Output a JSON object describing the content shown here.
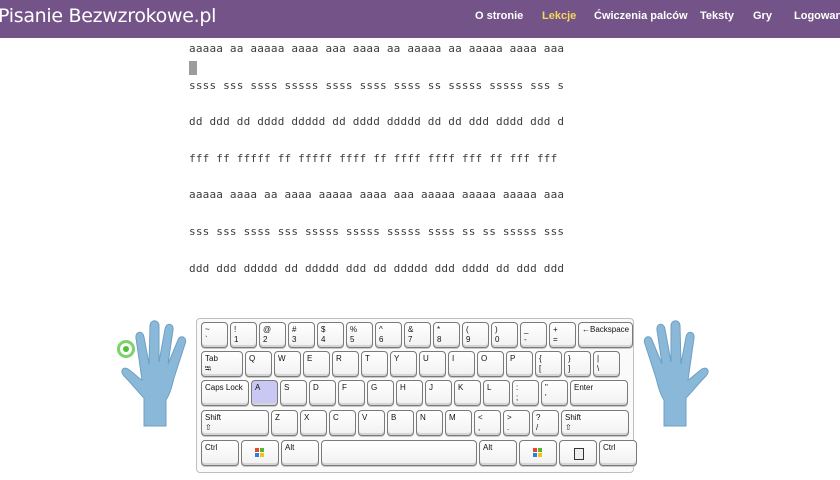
{
  "brand": "Pisanie Bezwzrokowe.pl",
  "nav": {
    "items": [
      {
        "label": "O stronie",
        "active": false
      },
      {
        "label": "Lekcje",
        "active": true
      },
      {
        "label": "Ćwiczenia palców",
        "active": false
      },
      {
        "label": "Teksty",
        "active": false
      },
      {
        "label": "Gry",
        "active": false
      },
      {
        "label": "Logowanie",
        "active": false
      }
    ]
  },
  "exercise": {
    "lines": [
      "aaaaa aa aaaaa aaaa aaa aaaa aa aaaaa aa aaaaa aaaa aaa",
      "ssss sss ssss sssss ssss ssss ssss ss sssss sssss sss s",
      "dd ddd dd dddd ddddd dd dddd ddddd dd dd ddd dddd ddd d",
      "fff ff fffff ff fffff ffff ff ffff ffff fff ff fff fff",
      "aaaaa aaaa aa aaaa aaaaa aaaa aaa aaaaa aaaaa aaaaa aaa",
      "sss sss ssss sss sssss sssss sssss ssss ss ss sssss sss",
      "ddd ddd ddddd dd ddddd ddd dd ddddd ddd dddd dd ddd ddd"
    ]
  },
  "keyboard": {
    "highlighted_key": "A",
    "rows": [
      [
        {
          "top": "~",
          "bottom": "`"
        },
        {
          "top": "!",
          "bottom": "1"
        },
        {
          "top": "@",
          "bottom": "2"
        },
        {
          "top": "#",
          "bottom": "3"
        },
        {
          "top": "$",
          "bottom": "4"
        },
        {
          "top": "%",
          "bottom": "5"
        },
        {
          "top": "^",
          "bottom": "6"
        },
        {
          "top": "&",
          "bottom": "7"
        },
        {
          "top": "*",
          "bottom": "8"
        },
        {
          "top": "(",
          "bottom": "9"
        },
        {
          "top": ")",
          "bottom": "0"
        },
        {
          "top": "_",
          "bottom": "-"
        },
        {
          "top": "+",
          "bottom": "="
        },
        {
          "top": "←Backspace",
          "bottom": ""
        }
      ],
      [
        {
          "top": "Tab",
          "bottom": "⭾"
        },
        {
          "top": "Q",
          "bottom": ""
        },
        {
          "top": "W",
          "bottom": ""
        },
        {
          "top": "E",
          "bottom": ""
        },
        {
          "top": "R",
          "bottom": ""
        },
        {
          "top": "T",
          "bottom": ""
        },
        {
          "top": "Y",
          "bottom": ""
        },
        {
          "top": "U",
          "bottom": ""
        },
        {
          "top": "I",
          "bottom": ""
        },
        {
          "top": "O",
          "bottom": ""
        },
        {
          "top": "P",
          "bottom": ""
        },
        {
          "top": "{",
          "bottom": "["
        },
        {
          "top": "}",
          "bottom": "]"
        },
        {
          "top": "|",
          "bottom": "\\"
        }
      ],
      [
        {
          "top": "Caps Lock",
          "bottom": ""
        },
        {
          "top": "A",
          "bottom": ""
        },
        {
          "top": "S",
          "bottom": ""
        },
        {
          "top": "D",
          "bottom": ""
        },
        {
          "top": "F",
          "bottom": ""
        },
        {
          "top": "G",
          "bottom": ""
        },
        {
          "top": "H",
          "bottom": ""
        },
        {
          "top": "J",
          "bottom": ""
        },
        {
          "top": "K",
          "bottom": ""
        },
        {
          "top": "L",
          "bottom": ""
        },
        {
          "top": ":",
          "bottom": ";"
        },
        {
          "top": "\"",
          "bottom": "'"
        },
        {
          "top": "Enter",
          "bottom": ""
        }
      ],
      [
        {
          "top": "Shift",
          "bottom": "⇧"
        },
        {
          "top": "Z",
          "bottom": ""
        },
        {
          "top": "X",
          "bottom": ""
        },
        {
          "top": "C",
          "bottom": ""
        },
        {
          "top": "V",
          "bottom": ""
        },
        {
          "top": "B",
          "bottom": ""
        },
        {
          "top": "N",
          "bottom": ""
        },
        {
          "top": "M",
          "bottom": ""
        },
        {
          "top": "<",
          "bottom": ","
        },
        {
          "top": ">",
          "bottom": "."
        },
        {
          "top": "?",
          "bottom": "/"
        },
        {
          "top": "Shift",
          "bottom": "⇧"
        }
      ],
      [
        {
          "top": "Ctrl",
          "bottom": "",
          "icon": ""
        },
        {
          "top": "",
          "bottom": "",
          "icon": "windows-icon"
        },
        {
          "top": "Alt",
          "bottom": "",
          "icon": ""
        },
        {
          "top": "",
          "bottom": "",
          "icon": ""
        },
        {
          "top": "Alt",
          "bottom": "",
          "icon": ""
        },
        {
          "top": "",
          "bottom": "",
          "icon": "windows-icon"
        },
        {
          "top": "",
          "bottom": "",
          "icon": "menu-icon"
        },
        {
          "top": "Ctrl",
          "bottom": "",
          "icon": ""
        }
      ]
    ]
  },
  "colors": {
    "navbar": "#745488",
    "nav_active": "#f4d85a",
    "hand": "#8ab8d8",
    "key_highlight": "#c9c8f4",
    "finger_marker": "#7bd36a"
  }
}
